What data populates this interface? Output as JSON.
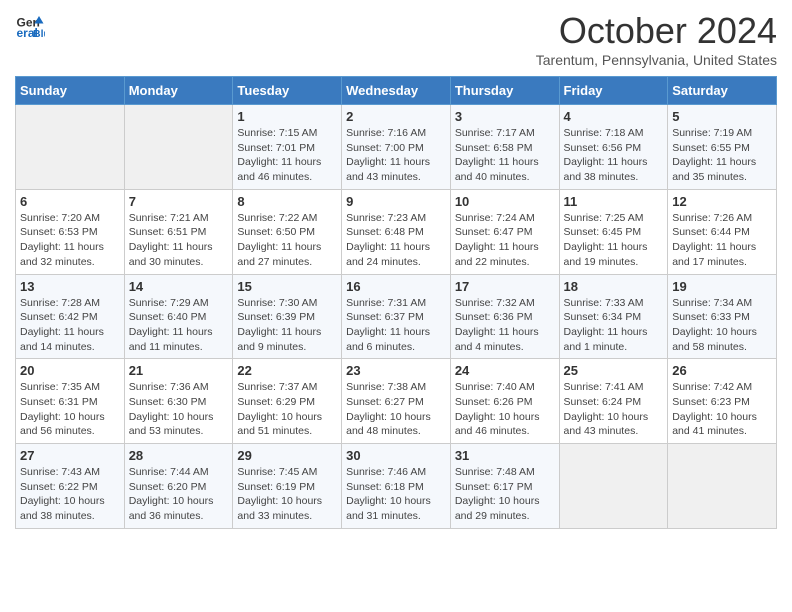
{
  "header": {
    "logo_line1": "General",
    "logo_line2": "Blue",
    "month_title": "October 2024",
    "subtitle": "Tarentum, Pennsylvania, United States"
  },
  "days_of_week": [
    "Sunday",
    "Monday",
    "Tuesday",
    "Wednesday",
    "Thursday",
    "Friday",
    "Saturday"
  ],
  "weeks": [
    [
      {
        "day": "",
        "info": ""
      },
      {
        "day": "",
        "info": ""
      },
      {
        "day": "1",
        "info": "Sunrise: 7:15 AM\nSunset: 7:01 PM\nDaylight: 11 hours and 46 minutes."
      },
      {
        "day": "2",
        "info": "Sunrise: 7:16 AM\nSunset: 7:00 PM\nDaylight: 11 hours and 43 minutes."
      },
      {
        "day": "3",
        "info": "Sunrise: 7:17 AM\nSunset: 6:58 PM\nDaylight: 11 hours and 40 minutes."
      },
      {
        "day": "4",
        "info": "Sunrise: 7:18 AM\nSunset: 6:56 PM\nDaylight: 11 hours and 38 minutes."
      },
      {
        "day": "5",
        "info": "Sunrise: 7:19 AM\nSunset: 6:55 PM\nDaylight: 11 hours and 35 minutes."
      }
    ],
    [
      {
        "day": "6",
        "info": "Sunrise: 7:20 AM\nSunset: 6:53 PM\nDaylight: 11 hours and 32 minutes."
      },
      {
        "day": "7",
        "info": "Sunrise: 7:21 AM\nSunset: 6:51 PM\nDaylight: 11 hours and 30 minutes."
      },
      {
        "day": "8",
        "info": "Sunrise: 7:22 AM\nSunset: 6:50 PM\nDaylight: 11 hours and 27 minutes."
      },
      {
        "day": "9",
        "info": "Sunrise: 7:23 AM\nSunset: 6:48 PM\nDaylight: 11 hours and 24 minutes."
      },
      {
        "day": "10",
        "info": "Sunrise: 7:24 AM\nSunset: 6:47 PM\nDaylight: 11 hours and 22 minutes."
      },
      {
        "day": "11",
        "info": "Sunrise: 7:25 AM\nSunset: 6:45 PM\nDaylight: 11 hours and 19 minutes."
      },
      {
        "day": "12",
        "info": "Sunrise: 7:26 AM\nSunset: 6:44 PM\nDaylight: 11 hours and 17 minutes."
      }
    ],
    [
      {
        "day": "13",
        "info": "Sunrise: 7:28 AM\nSunset: 6:42 PM\nDaylight: 11 hours and 14 minutes."
      },
      {
        "day": "14",
        "info": "Sunrise: 7:29 AM\nSunset: 6:40 PM\nDaylight: 11 hours and 11 minutes."
      },
      {
        "day": "15",
        "info": "Sunrise: 7:30 AM\nSunset: 6:39 PM\nDaylight: 11 hours and 9 minutes."
      },
      {
        "day": "16",
        "info": "Sunrise: 7:31 AM\nSunset: 6:37 PM\nDaylight: 11 hours and 6 minutes."
      },
      {
        "day": "17",
        "info": "Sunrise: 7:32 AM\nSunset: 6:36 PM\nDaylight: 11 hours and 4 minutes."
      },
      {
        "day": "18",
        "info": "Sunrise: 7:33 AM\nSunset: 6:34 PM\nDaylight: 11 hours and 1 minute."
      },
      {
        "day": "19",
        "info": "Sunrise: 7:34 AM\nSunset: 6:33 PM\nDaylight: 10 hours and 58 minutes."
      }
    ],
    [
      {
        "day": "20",
        "info": "Sunrise: 7:35 AM\nSunset: 6:31 PM\nDaylight: 10 hours and 56 minutes."
      },
      {
        "day": "21",
        "info": "Sunrise: 7:36 AM\nSunset: 6:30 PM\nDaylight: 10 hours and 53 minutes."
      },
      {
        "day": "22",
        "info": "Sunrise: 7:37 AM\nSunset: 6:29 PM\nDaylight: 10 hours and 51 minutes."
      },
      {
        "day": "23",
        "info": "Sunrise: 7:38 AM\nSunset: 6:27 PM\nDaylight: 10 hours and 48 minutes."
      },
      {
        "day": "24",
        "info": "Sunrise: 7:40 AM\nSunset: 6:26 PM\nDaylight: 10 hours and 46 minutes."
      },
      {
        "day": "25",
        "info": "Sunrise: 7:41 AM\nSunset: 6:24 PM\nDaylight: 10 hours and 43 minutes."
      },
      {
        "day": "26",
        "info": "Sunrise: 7:42 AM\nSunset: 6:23 PM\nDaylight: 10 hours and 41 minutes."
      }
    ],
    [
      {
        "day": "27",
        "info": "Sunrise: 7:43 AM\nSunset: 6:22 PM\nDaylight: 10 hours and 38 minutes."
      },
      {
        "day": "28",
        "info": "Sunrise: 7:44 AM\nSunset: 6:20 PM\nDaylight: 10 hours and 36 minutes."
      },
      {
        "day": "29",
        "info": "Sunrise: 7:45 AM\nSunset: 6:19 PM\nDaylight: 10 hours and 33 minutes."
      },
      {
        "day": "30",
        "info": "Sunrise: 7:46 AM\nSunset: 6:18 PM\nDaylight: 10 hours and 31 minutes."
      },
      {
        "day": "31",
        "info": "Sunrise: 7:48 AM\nSunset: 6:17 PM\nDaylight: 10 hours and 29 minutes."
      },
      {
        "day": "",
        "info": ""
      },
      {
        "day": "",
        "info": ""
      }
    ]
  ]
}
